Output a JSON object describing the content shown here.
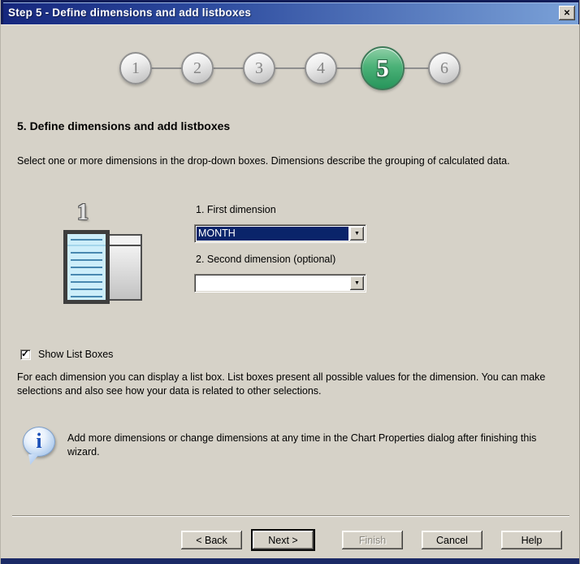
{
  "window": {
    "title": "Step 5 - Define dimensions and add listboxes"
  },
  "icons": {
    "close": "✕",
    "dropdown_arrow": "▼",
    "checkmark": "✓",
    "info": "i"
  },
  "steps": {
    "items": [
      "1",
      "2",
      "3",
      "4",
      "5",
      "6"
    ],
    "active_step": "5"
  },
  "content": {
    "heading": "5. Define dimensions and add listboxes",
    "intro": "Select one or more dimensions in the drop-down boxes. Dimensions describe the grouping of calculated data.",
    "illustration_number": "1",
    "first_dimension": {
      "label": "1. First dimension",
      "value": "MONTH"
    },
    "second_dimension": {
      "label": "2. Second dimension (optional)",
      "value": ""
    },
    "show_list_boxes": {
      "label": "Show List Boxes",
      "checked": true
    },
    "listbox_help": "For each dimension you can display a list box. List boxes present all possible values for the dimension. You can make selections and also see how your data is related to other selections.",
    "info_note": "Add more dimensions or change dimensions at any time in the Chart Properties dialog after finishing this wizard."
  },
  "buttons": {
    "back": "< Back",
    "next": "Next >",
    "finish": "Finish",
    "cancel": "Cancel",
    "help": "Help"
  },
  "colors": {
    "titlebar_gradient_left": "#16277d",
    "titlebar_gradient_right": "#7ba2d8",
    "dialog_background": "#d6d2c8",
    "active_step_green": "#2f9c62",
    "selection_navy": "#0a246a"
  }
}
